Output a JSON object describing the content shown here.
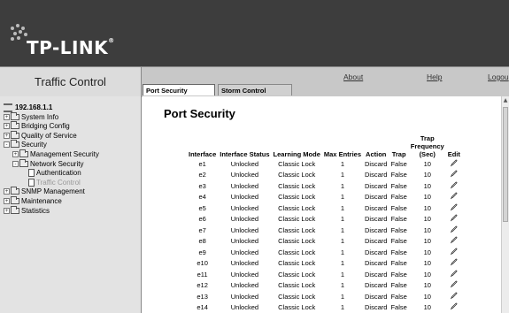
{
  "header": {
    "brand": "TP-LINK",
    "trademark": "®"
  },
  "sidebar": {
    "title": "Traffic Control",
    "items": [
      {
        "label": "192.168.1.1",
        "indent": 0,
        "type": "root"
      },
      {
        "label": "System Info",
        "indent": 0,
        "type": "folder",
        "toggle": "+"
      },
      {
        "label": "Bridging Config",
        "indent": 0,
        "type": "folder",
        "toggle": "+"
      },
      {
        "label": "Quality of Service",
        "indent": 0,
        "type": "folder",
        "toggle": "+"
      },
      {
        "label": "Security",
        "indent": 0,
        "type": "folder",
        "toggle": "-"
      },
      {
        "label": "Management Security",
        "indent": 1,
        "type": "folder",
        "toggle": "+"
      },
      {
        "label": "Network Security",
        "indent": 1,
        "type": "folder",
        "toggle": "-"
      },
      {
        "label": "Authentication",
        "indent": 2,
        "type": "page"
      },
      {
        "label": "Traffic Control",
        "indent": 2,
        "type": "page",
        "disabled": true
      },
      {
        "label": "SNMP Management",
        "indent": 0,
        "type": "folder",
        "toggle": "+"
      },
      {
        "label": "Maintenance",
        "indent": 0,
        "type": "folder",
        "toggle": "+"
      },
      {
        "label": "Statistics",
        "indent": 0,
        "type": "folder",
        "toggle": "+"
      }
    ]
  },
  "topnav": {
    "about": "About",
    "help": "Help",
    "logout": "Logou"
  },
  "tabs": {
    "active": "Port Security",
    "inactive": "Storm Control"
  },
  "main": {
    "title": "Port Security",
    "columns": [
      "Interface",
      "Interface Status",
      "Learning Mode",
      "Max Entries",
      "Action",
      "Trap",
      "Trap Frequency (Sec)",
      "Edit"
    ],
    "rows": [
      [
        "e1",
        "Unlocked",
        "Classic Lock",
        "1",
        "Discard",
        "False",
        "10"
      ],
      [
        "e2",
        "Unlocked",
        "Classic Lock",
        "1",
        "Discard",
        "False",
        "10"
      ],
      [
        "e3",
        "Unlocked",
        "Classic Lock",
        "1",
        "Discard",
        "False",
        "10"
      ],
      [
        "e4",
        "Unlocked",
        "Classic Lock",
        "1",
        "Discard",
        "False",
        "10"
      ],
      [
        "e5",
        "Unlocked",
        "Classic Lock",
        "1",
        "Discard",
        "False",
        "10"
      ],
      [
        "e6",
        "Unlocked",
        "Classic Lock",
        "1",
        "Discard",
        "False",
        "10"
      ],
      [
        "e7",
        "Unlocked",
        "Classic Lock",
        "1",
        "Discard",
        "False",
        "10"
      ],
      [
        "e8",
        "Unlocked",
        "Classic Lock",
        "1",
        "Discard",
        "False",
        "10"
      ],
      [
        "e9",
        "Unlocked",
        "Classic Lock",
        "1",
        "Discard",
        "False",
        "10"
      ],
      [
        "e10",
        "Unlocked",
        "Classic Lock",
        "1",
        "Discard",
        "False",
        "10"
      ],
      [
        "e11",
        "Unlocked",
        "Classic Lock",
        "1",
        "Discard",
        "False",
        "10"
      ],
      [
        "e12",
        "Unlocked",
        "Classic Lock",
        "1",
        "Discard",
        "False",
        "10"
      ],
      [
        "e13",
        "Unlocked",
        "Classic Lock",
        "1",
        "Discard",
        "False",
        "10"
      ],
      [
        "e14",
        "Unlocked",
        "Classic Lock",
        "1",
        "Discard",
        "False",
        "10"
      ]
    ],
    "edit_icon": "pencil-icon"
  },
  "colors": {
    "header_bg": "#3d3d3d",
    "nav_bg": "#c8c8c8",
    "sidebar_bg": "#e3e3e3"
  }
}
